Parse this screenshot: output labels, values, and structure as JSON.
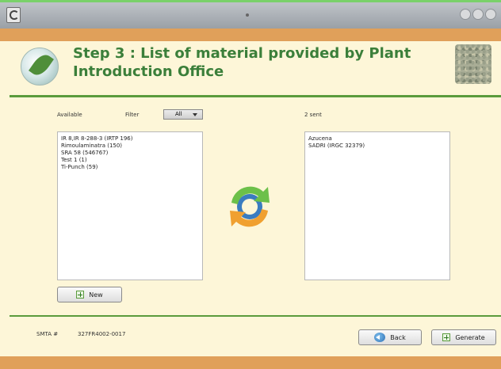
{
  "window": {
    "colors": {
      "accent_green": "#3b7f3a",
      "band_orange": "#e0a05a",
      "panel_bg": "#fdf6d8"
    }
  },
  "header": {
    "title": "Step 3 : List of material provided by Plant Introduction Office"
  },
  "left_panel": {
    "available_label": "Available",
    "filter_label": "Filter",
    "filter_value": "All",
    "items": [
      "IR 8,IR 8-288-3 (IRTP 196)",
      "Rimoulaminatra (150)",
      "SRA 58 (546767)",
      "Test 1 (1)",
      "Ti-Punch (59)"
    ],
    "new_button": "New"
  },
  "right_panel": {
    "sent_label": "2 sent",
    "items": [
      "Azucena",
      "SADRI (IRGC 32379)"
    ]
  },
  "footer": {
    "smta_label": "SMTA #",
    "smta_value": "327FR4002-0017",
    "back_button": "Back",
    "generate_button": "Generate"
  }
}
